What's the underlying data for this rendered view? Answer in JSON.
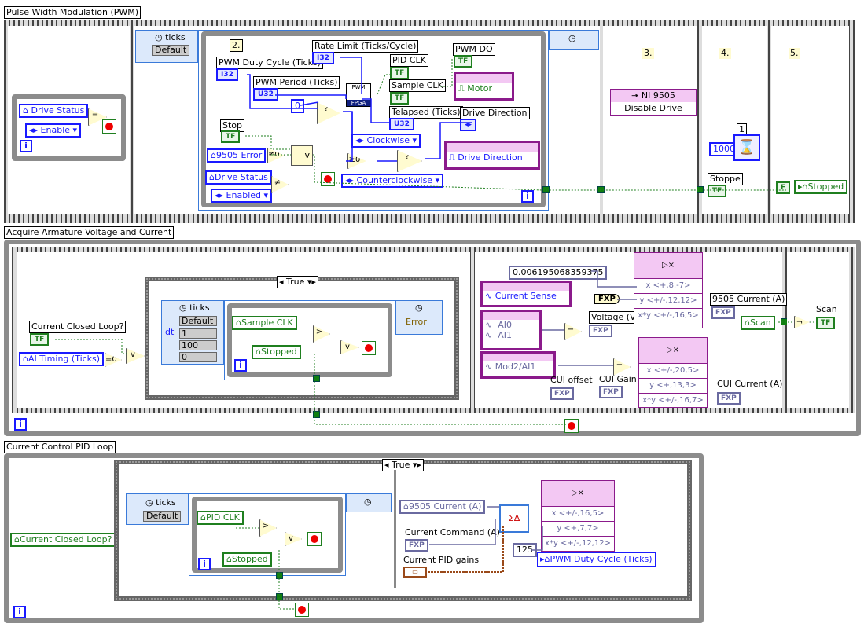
{
  "sections": {
    "pwm": "Pulse Width Modulation (PWM)",
    "acquire": "Acquire Armature Voltage and Current",
    "pid": "Current Control PID Loop"
  },
  "pwm": {
    "frame0": {
      "drive_status": "Drive Status",
      "enable": "Enable"
    },
    "frame1": {
      "ticks": "ticks",
      "default": "Default",
      "step": "2.",
      "pwm_duty": "PWM Duty Cycle (Ticks)",
      "pwm_period": "PWM Period (Ticks)",
      "rate_limit": "Rate Limit (Ticks/Cycle)",
      "i32": "I32",
      "u32": "U32",
      "zero": "0",
      "pwm_node": "PWM",
      "fpga": "FPGA",
      "pid_clk": "PID CLK",
      "sample_clk": "Sample CLK",
      "telapsed": "Telapsed (Ticks)",
      "pwm_do": "PWM DO",
      "motor": "Motor",
      "drive_direction": "Drive Direction",
      "stop": "Stop",
      "error_9505": "9505 Error",
      "drive_status": "Drive Status",
      "enabled": "Enabled",
      "clockwise": "Clockwise",
      "counterclockwise": "Counterclockwise",
      "tf": "TF"
    },
    "frame2": {
      "step": "3.",
      "ni9505": "NI 9505",
      "disable_drive": "Disable Drive"
    },
    "frame3": {
      "step": "4.",
      "wait_ms": "1000",
      "count": "1",
      "stopped_lbl": "Stoppe"
    },
    "frame4": {
      "step": "5.",
      "false_const": "F",
      "stopped": "Stopped"
    }
  },
  "acquire": {
    "current_closed_loop": "Current Closed Loop?",
    "ai_timing": "AI Timing (Ticks)",
    "case_value": "True",
    "ticks": "ticks",
    "default": "Default",
    "dt_lbl": "dt",
    "dt": "1",
    "offset": "100",
    "priority": "0",
    "error": "Error",
    "sample_clk": "Sample CLK",
    "stopped": "Stopped",
    "constant": "0.006195068359375",
    "current_sense": "Current Sense",
    "ai0": "AI0",
    "ai1": "AI1",
    "mod2_ai1": "Mod2/AI1",
    "mult1": {
      "x": "x <+,8,-7>",
      "y": "y <+/-,12,12>",
      "xy": "x*y <+/-,16,5>"
    },
    "mult2": {
      "x": "x <+/-,20,5>",
      "y": "y <+,13,3>",
      "xy": "x*y <+/-,16,7>"
    },
    "voltage": "Voltage (V)",
    "current_9505": "9505 Current (A)",
    "cui_offset": "CUI offset",
    "cui_gain": "CUI Gain",
    "cui_current": "CUI Current (A)",
    "scan": "Scan",
    "scan_local": "Scan",
    "fxp": "FXP"
  },
  "pid": {
    "current_closed_loop": "Current Closed Loop?",
    "case_value": "True",
    "ticks": "ticks",
    "default": "Default",
    "pid_clk": "PID CLK",
    "stopped": "Stopped",
    "current_9505": "9505 Current (A)",
    "current_command": "Current Command (A)",
    "pid_gains": "Current PID gains",
    "const_125": "125",
    "mult": {
      "x": "x <+/-,16,5>",
      "y": "y <+,7,7>",
      "xy": "x*y <+/-,12,12>"
    },
    "pwm_duty": "PWM Duty Cycle (Ticks)"
  }
}
